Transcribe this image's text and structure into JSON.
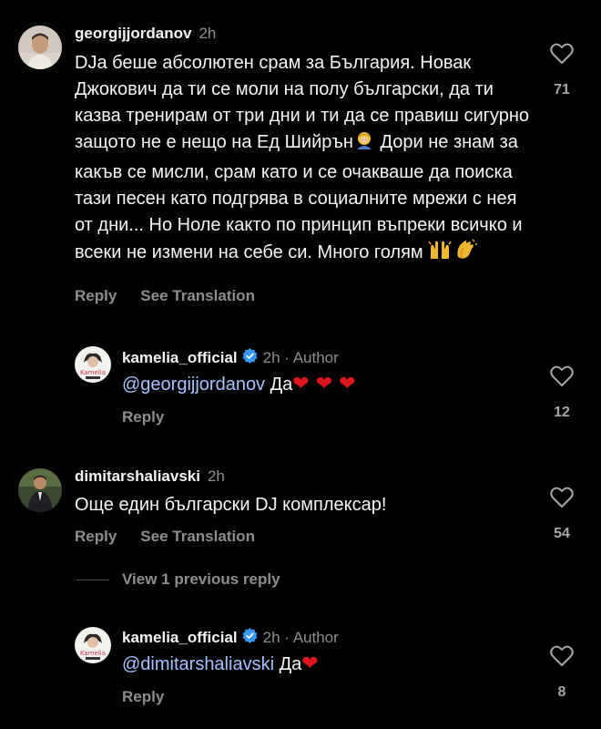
{
  "comments": [
    {
      "username": "georgijjordanov",
      "time": "2h",
      "text": "DJa беше абсолютен срам за България. Новак Джокович да ти се моли на полу български, да ти казва тренирам от три дни и ти да се правиш сигурно защото не е нещо на Ед Шийрън",
      "text_cont": " Дори не знам за какъв се мисли, срам като и се очакваше да поиска тази песен като подгрява в социалните мрежи с нея от дни... Но Ноле както по принцип въпреки всичко и всеки не измени на себе си. Много голям ",
      "reply_label": "Reply",
      "translate_label": "See Translation",
      "likes": "71"
    },
    {
      "username": "kamelia_official",
      "time": "2h · Author",
      "mention": "@georgijjordanov",
      "text": " Да",
      "reply_label": "Reply",
      "likes": "12"
    },
    {
      "username": "dimitarshaliavski",
      "time": "2h",
      "text": "Още един български DJ комплексар!",
      "reply_label": "Reply",
      "translate_label": "See Translation",
      "likes": "54"
    },
    {
      "view_previous": "View 1 previous reply"
    },
    {
      "username": "kamelia_official",
      "time": "2h · Author",
      "mention": "@dimitarshaliavski",
      "text": " Да",
      "reply_label": "Reply",
      "likes": "8"
    }
  ],
  "colors": {
    "background": "#000000",
    "secondary_text": "#8e8e8e",
    "mention": "#a5c2ff",
    "verified": "#3897f0",
    "heart": "#e0161e"
  }
}
